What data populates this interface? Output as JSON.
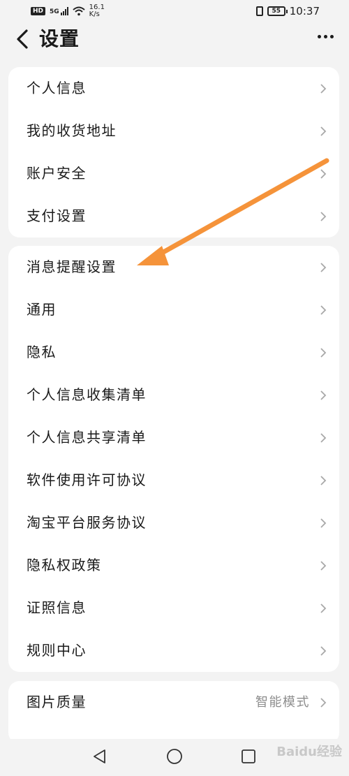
{
  "status_bar": {
    "hd_badge": "HD",
    "network": "5G",
    "speed_value": "16.1",
    "speed_unit": "K/s",
    "battery": "55",
    "time": "10:37"
  },
  "header": {
    "title": "设置"
  },
  "groups": [
    {
      "items": [
        {
          "label": "个人信息"
        },
        {
          "label": "我的收货地址"
        },
        {
          "label": "账户安全"
        },
        {
          "label": "支付设置"
        }
      ]
    },
    {
      "items": [
        {
          "label": "消息提醒设置"
        },
        {
          "label": "通用"
        },
        {
          "label": "隐私"
        },
        {
          "label": "个人信息收集清单"
        },
        {
          "label": "个人信息共享清单"
        },
        {
          "label": "软件使用许可协议"
        },
        {
          "label": "淘宝平台服务协议"
        },
        {
          "label": "隐私权政策"
        },
        {
          "label": "证照信息"
        },
        {
          "label": "规则中心"
        }
      ]
    },
    {
      "items": [
        {
          "label": "图片质量",
          "value": "智能模式"
        }
      ]
    }
  ],
  "annotation": {
    "arrow_color": "#f5933a"
  },
  "watermark": "Baidu经验",
  "colors": {
    "background": "#f3f3f3",
    "card": "#ffffff",
    "chevron": "#a8a8a8",
    "secondary_text": "#8c8c8c"
  },
  "icons": [
    "back-arrow-icon",
    "more-icon",
    "chevron-right-icon",
    "nav-back-icon",
    "nav-home-icon",
    "nav-recents-icon"
  ]
}
